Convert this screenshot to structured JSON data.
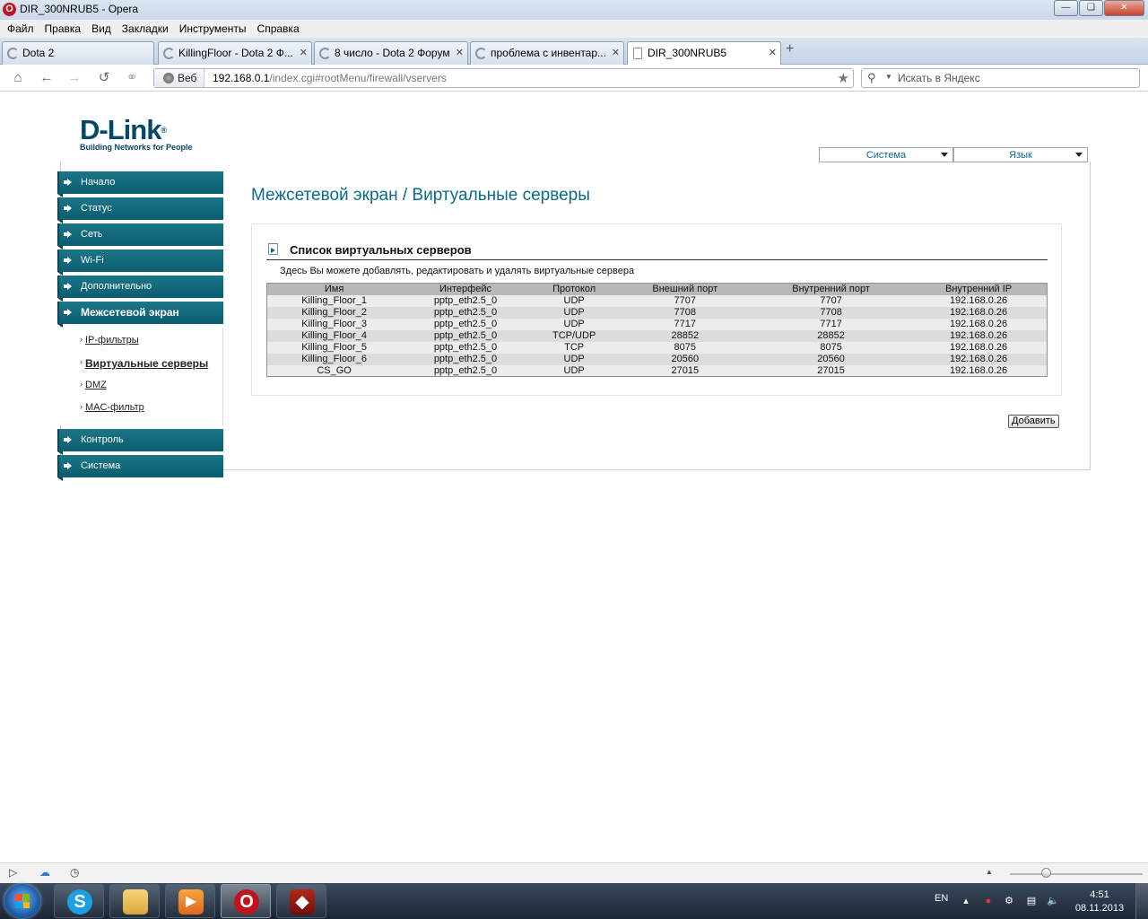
{
  "window": {
    "title": "DIR_300NRUB5 - Opera"
  },
  "menu": [
    "Файл",
    "Правка",
    "Вид",
    "Закладки",
    "Инструменты",
    "Справка"
  ],
  "tabs": [
    {
      "label": "Dota 2"
    },
    {
      "label": "KillingFloor - Dota 2 Ф..."
    },
    {
      "label": "8 число - Dota 2 Форум"
    },
    {
      "label": "проблема с инвентар..."
    },
    {
      "label": "DIR_300NRUB5"
    }
  ],
  "address": {
    "badge": "Веб",
    "host": "192.168.0.1",
    "path": "/index.cgi#rootMenu/firewall/vservers",
    "search_placeholder": "Искать в Яндекс"
  },
  "router": {
    "logo_brand": "D-Link",
    "logo_tagline": "Building Networks for People",
    "top_selects": [
      "Система",
      "Язык"
    ],
    "nav": {
      "home": "Начало",
      "status": "Статус",
      "network": "Сеть",
      "wifi": "Wi-Fi",
      "advanced": "Дополнительно",
      "firewall": "Межсетевой экран",
      "control": "Контроль",
      "system": "Система"
    },
    "subnav": {
      "ip_filters": "IP-фильтры",
      "vservers": "Виртуальные серверы",
      "dmz": "DMZ",
      "mac_filter": "MAC-фильтр"
    },
    "page_title": "Межсетевой экран  / Виртуальные серверы",
    "panel_title": "Список виртуальных серверов",
    "panel_desc": "Здесь Вы можете добавлять, редактировать и удалять виртуальные сервера",
    "table": {
      "headers": [
        "Имя",
        "Интерфейс",
        "Протокол",
        "Внешний порт",
        "Внутренний порт",
        "Внутренний IP"
      ],
      "rows": [
        [
          "Killing_Floor_1",
          "pptp_eth2.5_0",
          "UDP",
          "7707",
          "7707",
          "192.168.0.26"
        ],
        [
          "Killing_Floor_2",
          "pptp_eth2.5_0",
          "UDP",
          "7708",
          "7708",
          "192.168.0.26"
        ],
        [
          "Killing_Floor_3",
          "pptp_eth2.5_0",
          "UDP",
          "7717",
          "7717",
          "192.168.0.26"
        ],
        [
          "Killing_Floor_4",
          "pptp_eth2.5_0",
          "TCP/UDP",
          "28852",
          "28852",
          "192.168.0.26"
        ],
        [
          "Killing_Floor_5",
          "pptp_eth2.5_0",
          "TCP",
          "8075",
          "8075",
          "192.168.0.26"
        ],
        [
          "Killing_Floor_6",
          "pptp_eth2.5_0",
          "UDP",
          "20560",
          "20560",
          "192.168.0.26"
        ],
        [
          "CS_GO",
          "pptp_eth2.5_0",
          "UDP",
          "27015",
          "27015",
          "192.168.0.26"
        ]
      ]
    },
    "add_button": "Добавить"
  },
  "taskbar": {
    "lang": "EN",
    "time": "4:51",
    "date": "08.11.2013"
  },
  "colors": {
    "nav_bg": "#0b5d70",
    "title_color": "#0c6a8d",
    "logo_color": "#06476a"
  }
}
